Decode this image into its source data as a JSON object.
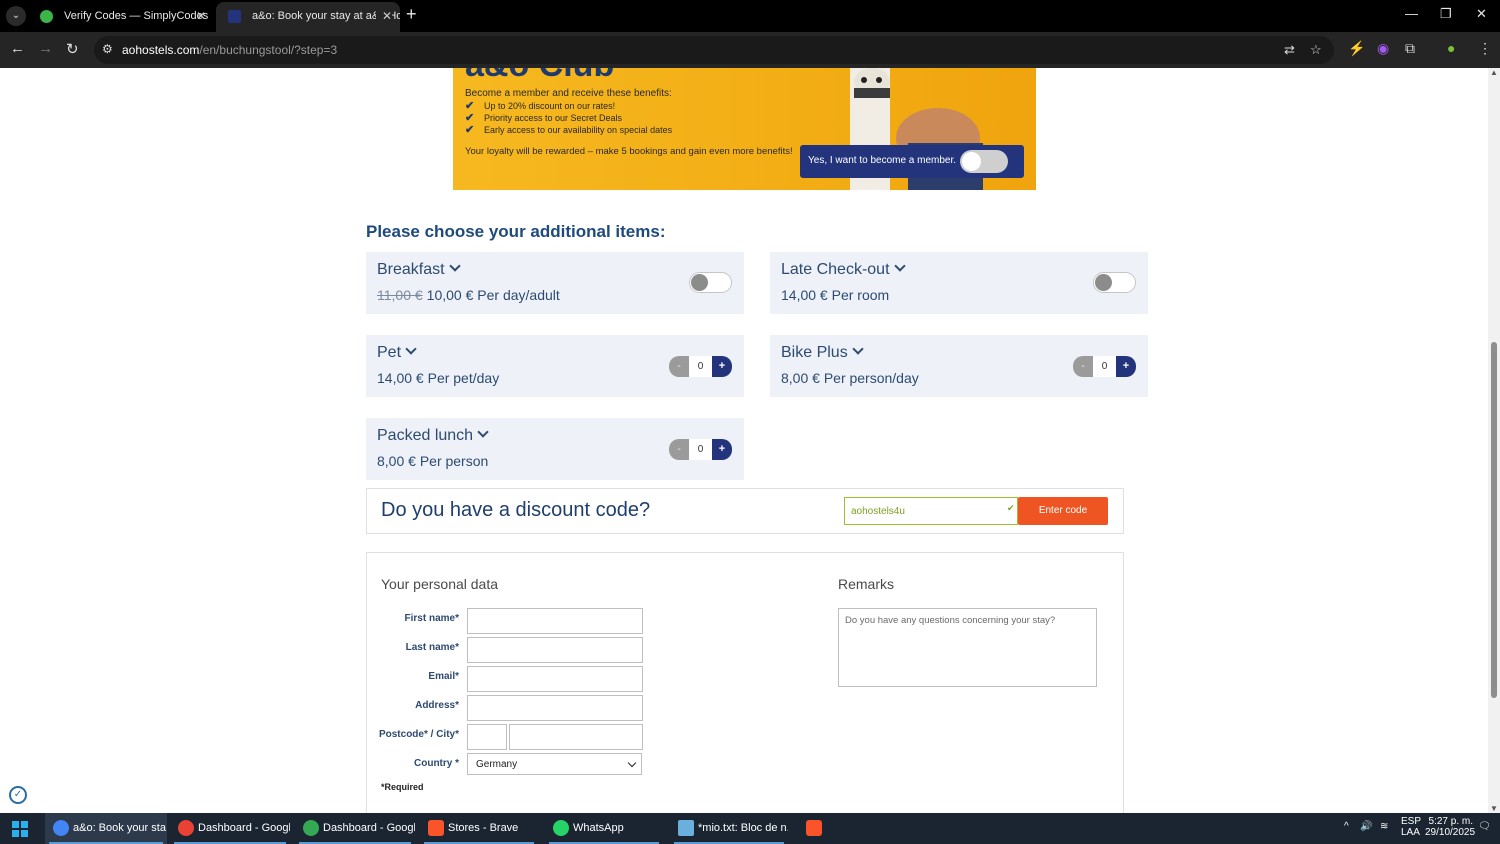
{
  "browser": {
    "tabs": [
      {
        "title": "Verify Codes — SimplyCodes",
        "active": false
      },
      {
        "title": "a&o: Book your stay at a&o Ho",
        "active": true
      }
    ],
    "url_host": "aohostels.com",
    "url_path": "/en/buchungstool/?step=3"
  },
  "banner": {
    "title": "a&o Club",
    "intro": "Become a member and receive these benefits:",
    "benefits": [
      "Up to 20% discount on our rates!",
      "Priority access to our Secret Deals",
      "Early access to our availability on special dates"
    ],
    "loyalty": "Your loyalty will be rewarded – make 5 bookings and gain even more benefits!",
    "member_label": "Yes, I want to become a member."
  },
  "items_title": "Please choose your additional items:",
  "items": {
    "breakfast": {
      "name": "Breakfast",
      "old_price": "11,00 €",
      "price": "10,00 € Per day/adult"
    },
    "late_checkout": {
      "name": "Late Check-out",
      "price": "14,00 € Per room"
    },
    "pet": {
      "name": "Pet",
      "price": "14,00 € Per pet/day",
      "qty": "0"
    },
    "bike_plus": {
      "name": "Bike Plus",
      "price": "8,00 € Per person/day",
      "qty": "0"
    },
    "packed_lunch": {
      "name": "Packed lunch",
      "price": "8,00 € Per person",
      "qty": "0"
    }
  },
  "stepper": {
    "minus": "-",
    "plus": "+"
  },
  "discount": {
    "question": "Do you have a discount code?",
    "code_value": "aohostels4u",
    "button": "Enter code"
  },
  "personal": {
    "title": "Your personal data",
    "first_name": "First name*",
    "last_name": "Last name*",
    "email": "Email*",
    "address": "Address*",
    "postcode_city": "Postcode* / City*",
    "country": "Country *",
    "country_value": "Germany",
    "required": "*Required",
    "remarks_title": "Remarks",
    "remarks_placeholder": "Do you have any questions concerning your stay?"
  },
  "taskbar": {
    "items": [
      {
        "label": "a&o: Book your sta...",
        "color": "#4285f4"
      },
      {
        "label": "Dashboard - Googl...",
        "color": "#e94235"
      },
      {
        "label": "Dashboard - Googl...",
        "color": "#34a853"
      },
      {
        "label": "Stores - Brave",
        "color": "#fb542b"
      },
      {
        "label": "WhatsApp",
        "color": "#25d366"
      },
      {
        "label": "*mio.txt: Bloc de n...",
        "color": "#6ab0de"
      }
    ],
    "lang": "ESP",
    "lang2": "LAA",
    "time": "5:27 p. m.",
    "date": "29/10/2025"
  },
  "colors": {
    "brand_blue": "#24347c",
    "accent_orange": "#ee5522",
    "banner_yellow": "#f3ad14",
    "valid_green": "#7da21e"
  }
}
